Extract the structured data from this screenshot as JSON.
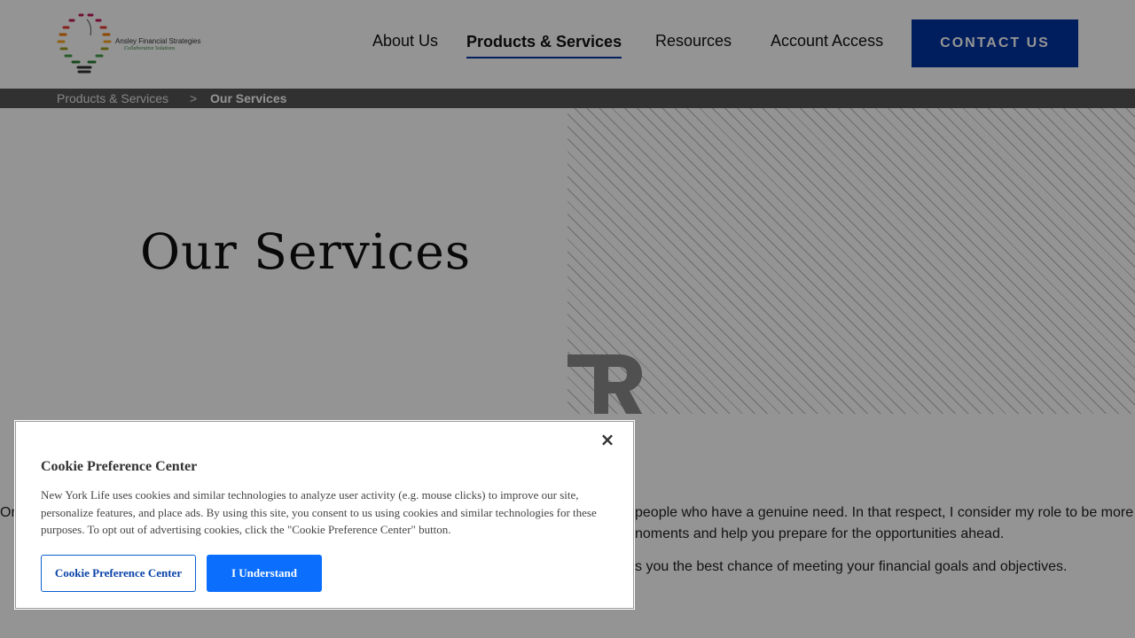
{
  "header": {
    "logo": {
      "name": "Ansley Financial Strategies",
      "tagline": "Collaborative Solutions",
      "icon": "lightbulb-logo-icon"
    },
    "nav": [
      {
        "label": "About Us",
        "active": false
      },
      {
        "label": "Products & Services",
        "active": true
      },
      {
        "label": "Resources",
        "active": false
      },
      {
        "label": "Account Access",
        "active": false
      }
    ],
    "contact_label": "CONTACT US",
    "accent_color": "#0033a0"
  },
  "breadcrumb": {
    "parent": "Products & Services",
    "separator": ">",
    "current": "Our Services"
  },
  "hero": {
    "title": "Our Services"
  },
  "content": {
    "line1_left": "Or",
    "line1_right": "people who have a genuine need. In that respect, I consider my role to be more",
    "line2_right": "noments and help you prepare for the opportunities ahead.",
    "line3_right": "s you the best chance of meeting your financial goals and objectives."
  },
  "cookie_dialog": {
    "title": "Cookie Preference Center",
    "body": "New York Life uses cookies and similar technologies to analyze user activity (e.g. mouse clicks) to improve our site, personalize features, and place ads. By using this site, you consent to us using cookies and similar technologies for these purposes. To opt out of advertising cookies, click the \"Cookie Preference Center\" button.",
    "close_symbol": "×",
    "pref_button": "Cookie Preference Center",
    "accept_button": "I Understand",
    "button_color": "#0b6efd"
  }
}
